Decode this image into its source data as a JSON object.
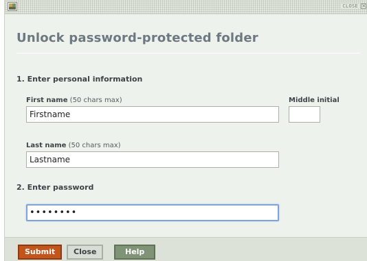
{
  "window": {
    "close_label": "CLOSE",
    "close_icon_glyph": "×"
  },
  "dialog": {
    "title": "Unlock password-protected folder"
  },
  "sections": {
    "personal": {
      "heading": "1. Enter personal information"
    },
    "password": {
      "heading": "2. Enter password"
    }
  },
  "fields": {
    "first_name": {
      "label": "First name",
      "hint": "(50 chars max)",
      "value": "Firstname"
    },
    "middle_initial": {
      "label": "Middle initial",
      "value": ""
    },
    "last_name": {
      "label": "Last name",
      "hint": "(50 chars max)",
      "value": "Lastname"
    },
    "password": {
      "value": "xxxxxxxx"
    }
  },
  "buttons": {
    "submit": "Submit",
    "close": "Close",
    "help": "Help"
  },
  "colors": {
    "submit_bg": "#c1551c",
    "help_bg": "#7f9476",
    "dialog_bg": "#eef2ec",
    "focus_border": "#7da3d9"
  },
  "icons": {
    "app": "app-icon",
    "close": "close-icon"
  }
}
